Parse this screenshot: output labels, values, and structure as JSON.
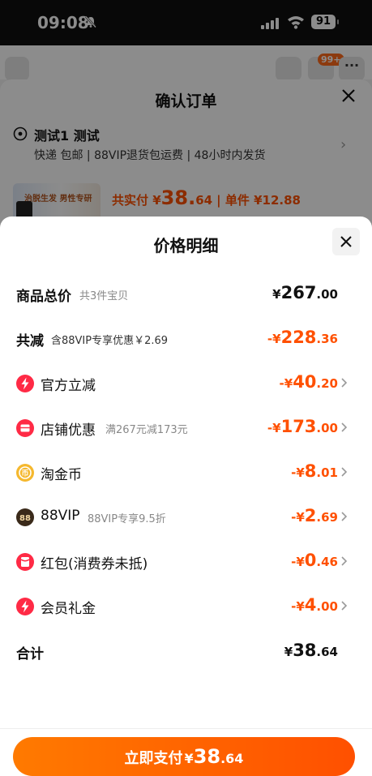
{
  "status_bar": {
    "time": "09:08",
    "battery": "91"
  },
  "top_nav": {
    "cart_badge": "99+"
  },
  "order": {
    "title": "确认订单",
    "address_name": "测试1 测试",
    "shipping_info": "快递 包邮 | 88VIP退货包运费 | 48小时内发货",
    "thumbnail_text": "治脱生发 男性专研",
    "paid_label": "共实付 ¥",
    "paid_amount_int": "38.",
    "paid_amount_dec": "64",
    "unit_price": "| 单件 ¥12.88"
  },
  "price_detail": {
    "title": "价格明细",
    "rows": [
      {
        "label": "商品总价",
        "note": "共3件宝贝",
        "symbol": "¥",
        "int": "267",
        "dec": ".00",
        "icon": ""
      },
      {
        "label": "共减",
        "note": "含88VIP专享优惠￥2.69",
        "symbol": "-¥",
        "int": "228",
        "dec": ".36",
        "icon": ""
      },
      {
        "label": "官方立减",
        "note": "",
        "symbol": "-¥",
        "int": "40",
        "dec": ".20",
        "icon": "lightning-icon"
      },
      {
        "label": "店铺优惠",
        "note": "满267元减173元",
        "symbol": "-¥",
        "int": "173",
        "dec": ".00",
        "icon": "store-coupon-icon"
      },
      {
        "label": "淘金币",
        "note": "",
        "symbol": "-¥",
        "int": "8",
        "dec": ".01",
        "icon": "gold-coin-icon"
      },
      {
        "label": "88VIP",
        "note": "88VIP专享9.5折",
        "symbol": "-¥",
        "int": "2",
        "dec": ".69",
        "icon": "88vip-icon"
      },
      {
        "label": "红包(消费券未抵)",
        "note": "",
        "symbol": "-¥",
        "int": "0",
        "dec": ".46",
        "icon": "red-packet-icon"
      },
      {
        "label": "会员礼金",
        "note": "",
        "symbol": "-¥",
        "int": "4",
        "dec": ".00",
        "icon": "lightning-icon"
      },
      {
        "label": "合计",
        "note": "",
        "symbol": "¥",
        "int": "38",
        "dec": ".64",
        "icon": ""
      }
    ]
  },
  "pay_button": {
    "label": "立即支付",
    "symbol": "¥",
    "int": "38",
    "dec": ".64"
  },
  "colors": {
    "accent": "#ff5000",
    "accent_light": "#ff7a00",
    "coin": "#f5b82e",
    "vip_dark": "#3a2a1a"
  }
}
